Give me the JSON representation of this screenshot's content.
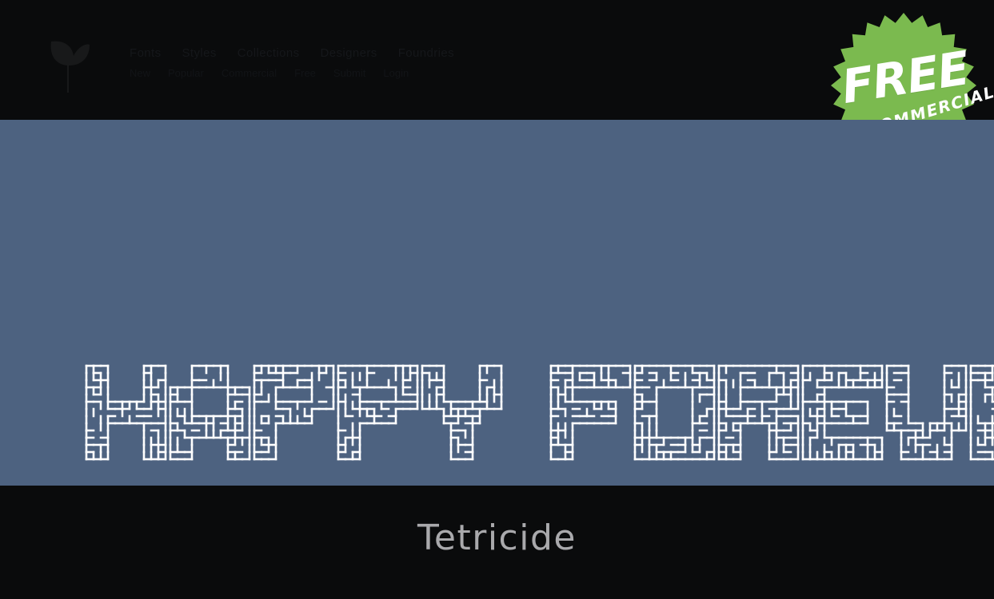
{
  "header": {
    "logo_icon": "leaf-logo-icon",
    "nav": [
      {
        "label": "Fonts"
      },
      {
        "label": "Styles"
      },
      {
        "label": "Collections"
      },
      {
        "label": "Designers"
      },
      {
        "label": "Foundries"
      }
    ],
    "sub": [
      {
        "label": "New"
      },
      {
        "label": "Popular"
      },
      {
        "label": "Commercial"
      },
      {
        "label": "Free"
      },
      {
        "label": "Submit"
      },
      {
        "label": "Login"
      }
    ]
  },
  "badge": {
    "title": "FREE",
    "ribbon": "FOR COMMERCIAL USE",
    "color": "#7bba4f",
    "text_color": "#ffffff",
    "points": 24
  },
  "preview": {
    "sample_text": "HAPPY FOREVER",
    "background_color": "#4d6280",
    "glyph_color": "#ffffff",
    "style": "maze-outline-tetris",
    "cell": 9,
    "stroke": 2.6
  },
  "footer": {
    "font_name": "Tetricide",
    "background_color": "#0a0b0c",
    "text_color": "#a9a9ac"
  },
  "chart_data": null
}
